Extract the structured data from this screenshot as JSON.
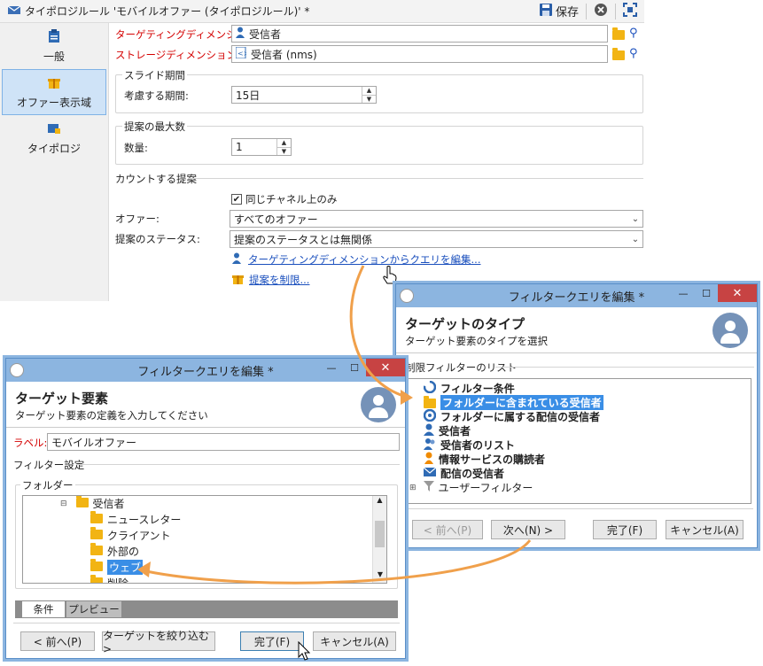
{
  "main": {
    "title": "タイポロジルール 'モバイルオファー (タイポロジルール)' *",
    "save_label": "保存",
    "sidebar": [
      {
        "label": "一般"
      },
      {
        "label": "オファー表示域"
      },
      {
        "label": "タイポロジ"
      }
    ],
    "targeting_dimension": {
      "label": "ターゲティングディメンション:",
      "value": "受信者"
    },
    "storage_dimension": {
      "label": "ストレージディメンション:",
      "value": "受信者 (nms)"
    },
    "sliding_period": {
      "title": "スライド期間",
      "label": "考慮する期間:",
      "value": "15日"
    },
    "max_proposals": {
      "title": "提案の最大数",
      "label": "数量:",
      "value": "1"
    },
    "counted_proposals": {
      "title": "カウントする提案"
    },
    "same_channel_only": {
      "label": "同じチャネル上のみ",
      "checked": true
    },
    "offer": {
      "label": "オファー:",
      "value": "すべてのオファー"
    },
    "proposal_status": {
      "label": "提案のステータス:",
      "value": "提案のステータスとは無関係"
    },
    "edit_query_link": "ターゲティングディメンションからクエリを編集...",
    "restrict_link": "提案を制限..."
  },
  "dialog_right": {
    "title": "フィルタークエリを編集 *",
    "heading": "ターゲットのタイプ",
    "subheading": "ターゲット要素のタイプを選択",
    "list_title": "制限フィルターのリスト",
    "items": [
      {
        "label": "フィルター条件",
        "icon": "filter-condition-icon"
      },
      {
        "label": "フォルダーに含まれている受信者",
        "icon": "folder-recipient-icon",
        "selected": true
      },
      {
        "label": "フォルダーに属する配信の受信者",
        "icon": "delivery-folder-icon"
      },
      {
        "label": "受信者",
        "icon": "recipient-icon"
      },
      {
        "label": "受信者のリスト",
        "icon": "recipient-list-icon"
      },
      {
        "label": "情報サービスの購読者",
        "icon": "subscriber-icon"
      },
      {
        "label": "配信の受信者",
        "icon": "delivery-recipient-icon"
      },
      {
        "label": "ユーザーフィルター",
        "icon": "funnel-icon"
      }
    ],
    "buttons": {
      "back": "< 前へ(P)",
      "next": "次へ(N) >",
      "finish": "完了(F)",
      "cancel": "キャンセル(A)"
    }
  },
  "dialog_left": {
    "title": "フィルタークエリを編集 *",
    "heading": "ターゲット要素",
    "subheading": "ターゲット要素の定義を入力してください",
    "label_label": "ラベル:",
    "label_value": "モバイルオファー",
    "filter_settings": "フィルター設定",
    "folder_group": "フォルダー",
    "tree": [
      {
        "label": "受信者",
        "level": 0,
        "expanded": true
      },
      {
        "label": "ニュースレター",
        "level": 1
      },
      {
        "label": "クライアント",
        "level": 1
      },
      {
        "label": "外部の",
        "level": 1
      },
      {
        "label": "ウェブ",
        "level": 1,
        "selected": true
      },
      {
        "label": "削除",
        "level": 1
      }
    ],
    "tabs": [
      "条件",
      "プレビュー"
    ],
    "buttons": {
      "back": "< 前へ(P)",
      "narrow": "ターゲットを絞り込む>",
      "finish": "完了(F)",
      "cancel": "キャンセル(A)"
    }
  },
  "colors": {
    "accent": "#3a8ee6",
    "dialog_frame": "#8cb5e0",
    "arrow": "#f0a04b",
    "required": "#d40000"
  }
}
